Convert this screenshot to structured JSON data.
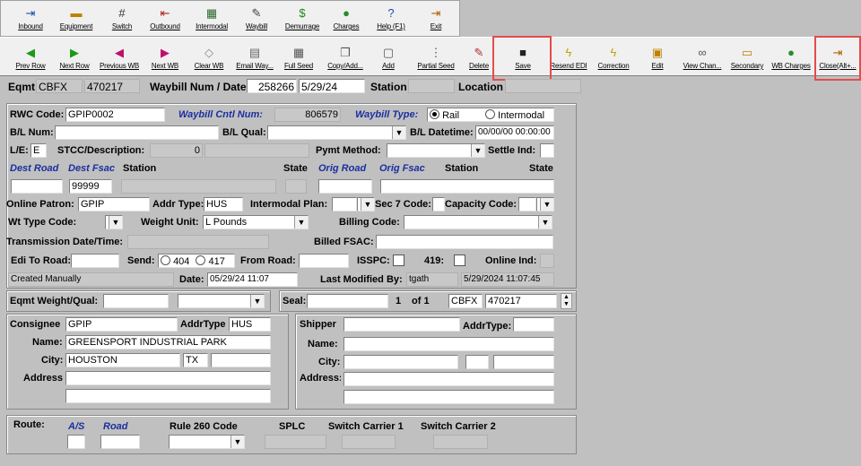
{
  "toolbar1": [
    {
      "label": "Inbound",
      "icon": "inbound-icon",
      "glyph": "⇥",
      "color": "#1a4fb0"
    },
    {
      "label": "Equipment",
      "icon": "equipment-icon",
      "glyph": "▬",
      "color": "#c08000"
    },
    {
      "label": "Switch",
      "icon": "switch-icon",
      "glyph": "#",
      "color": "#333"
    },
    {
      "label": "Outbound",
      "icon": "outbound-icon",
      "glyph": "⇤",
      "color": "#b02020"
    },
    {
      "label": "Intermodal",
      "icon": "intermodal-icon",
      "glyph": "▦",
      "color": "#2a6a2a"
    },
    {
      "label": "Waybill",
      "icon": "waybill-icon",
      "glyph": "✎",
      "color": "#444"
    },
    {
      "label": "Demurrage",
      "icon": "demurrage-icon",
      "glyph": "$",
      "color": "#1a8a1a"
    },
    {
      "label": "Charges",
      "icon": "charges-icon",
      "glyph": "●",
      "color": "#2a8a2a"
    },
    {
      "label": "Help (F1)",
      "icon": "help-icon",
      "glyph": "?",
      "color": "#1a4fb0"
    },
    {
      "label": "Exit",
      "icon": "exit-icon",
      "glyph": "⇥",
      "color": "#b06000"
    }
  ],
  "toolbar2": [
    {
      "label": "Prev Row",
      "icon": "prev-row-icon",
      "glyph": "◀",
      "color": "#1a9a1a"
    },
    {
      "label": "Next Row",
      "icon": "next-row-icon",
      "glyph": "▶",
      "color": "#1a9a1a"
    },
    {
      "label": "Previous WB",
      "icon": "previous-wb-icon",
      "glyph": "◀",
      "color": "#c0106a"
    },
    {
      "label": "Next WB",
      "icon": "next-wb-icon",
      "glyph": "▶",
      "color": "#c0106a"
    },
    {
      "label": "Clear WB",
      "icon": "clear-wb-icon",
      "glyph": "◇",
      "color": "#888"
    },
    {
      "label": "Email Way...",
      "icon": "email-waybill-icon",
      "glyph": "▤",
      "color": "#666"
    },
    {
      "label": "Full Seed",
      "icon": "full-seed-icon",
      "glyph": "▦",
      "color": "#555"
    },
    {
      "label": "Copy/Add...",
      "icon": "copy-add-icon",
      "glyph": "❐",
      "color": "#555"
    },
    {
      "label": "Add",
      "icon": "add-icon",
      "glyph": "▢",
      "color": "#555"
    },
    {
      "label": "Partial Seed",
      "icon": "partial-seed-icon",
      "glyph": "⋮",
      "color": "#555"
    },
    {
      "label": "Delete",
      "icon": "delete-icon",
      "glyph": "✎",
      "color": "#b03030"
    },
    {
      "label": "Save",
      "icon": "save-icon",
      "glyph": "■",
      "color": "#222"
    },
    {
      "label": "Resend EDI",
      "icon": "resend-edi-icon",
      "glyph": "ϟ",
      "color": "#c8a000"
    },
    {
      "label": "Correction",
      "icon": "correction-icon",
      "glyph": "ϟ",
      "color": "#c8a000"
    },
    {
      "label": "Edit",
      "icon": "edit-icon",
      "glyph": "▣",
      "color": "#c08000"
    },
    {
      "label": "View Chan...",
      "icon": "view-changes-icon",
      "glyph": "∞",
      "color": "#555"
    },
    {
      "label": "Secondary",
      "icon": "secondary-icon",
      "glyph": "▭",
      "color": "#c08000"
    },
    {
      "label": "WB Charges",
      "icon": "wb-charges-icon",
      "glyph": "●",
      "color": "#2a8a2a"
    },
    {
      "label": "Close(Alt+...",
      "icon": "close-icon",
      "glyph": "⇥",
      "color": "#b06000"
    }
  ],
  "header": {
    "eqmt_label": "Eqmt",
    "eqmt_init": "CBFX",
    "eqmt_num": "470217",
    "wb_label": "Waybill Num / Date",
    "wb_num": "258266",
    "wb_date": "5/29/24",
    "station_label": "Station",
    "station": "",
    "location_label": "Location",
    "location": ""
  },
  "form": {
    "rwc_label": "RWC Code:",
    "rwc": "GPIP0002",
    "cntl_label": "Waybill Cntl Num:",
    "cntl": "806579",
    "type_label": "Waybill Type:",
    "type_rail": "Rail",
    "type_intermodal": "Intermodal",
    "bl_num_label": "B/L Num:",
    "bl_num": "",
    "bl_qual_label": "B/L Qual:",
    "bl_qual": "",
    "bl_dt_label": "B/L Datetime:",
    "bl_dt": "00/00/00 00:00:00",
    "le_label": "L/E:",
    "le": "E",
    "stcc_label": "STCC/Description:",
    "stcc": "0",
    "stcc_desc": "",
    "pymt_label": "Pymt Method:",
    "pymt": "",
    "settle_label": "Settle Ind:",
    "settle": "",
    "dest_road_label": "Dest Road",
    "dest_fsac_label": "Dest Fsac",
    "dest_station_label": "Station",
    "dest_state_label": "State",
    "orig_road_label": "Orig Road",
    "orig_fsac_label": "Orig Fsac",
    "orig_station_label": "Station",
    "orig_state_label": "State",
    "dest_road": "",
    "dest_fsac": "99999",
    "dest_station": "",
    "dest_state": "",
    "orig_road": "",
    "orig_fsac": "",
    "online_label": "Online Patron:",
    "online": "GPIP",
    "addr_label": "Addr Type:",
    "addr": "HUS",
    "im_plan_label": "Intermodal Plan:",
    "im_plan": "",
    "sec7_label": "Sec 7 Code:",
    "sec7": "",
    "cap_label": "Capacity Code:",
    "cap": "",
    "wt_type_label": "Wt Type Code:",
    "wt_type": "",
    "wt_unit_label": "Weight Unit:",
    "wt_unit": "L Pounds",
    "billing_label": "Billing Code:",
    "billing": "",
    "trans_label": "Transmission Date/Time:",
    "trans": "",
    "billed_fsac_label": "Billed FSAC:",
    "billed_fsac": "",
    "edi_label": "Edi To Road:",
    "edi": "",
    "send_label": "Send:",
    "send_404": "404",
    "send_417": "417",
    "from_road_label": "From Road:",
    "from_road": "",
    "isspc_label": "ISSPC:",
    "n419_label": "419:",
    "online_ind_label": "Online Ind:",
    "online_ind": "",
    "created": "Created Manually",
    "date_label": "Date:",
    "date": "05/29/24 11:07",
    "lastmod_label": "Last Modified By:",
    "lastmod_user": "tgath",
    "lastmod_date": "5/29/2024 11:07:45"
  },
  "weight": {
    "label": "Eqmt Weight/Qual:",
    "value": "",
    "qual": ""
  },
  "seal": {
    "label": "Seal:",
    "value": "",
    "index": "1",
    "of": "of 1",
    "init": "CBFX",
    "num": "470217"
  },
  "consignee": {
    "label": "Consignee",
    "code": "GPIP",
    "addrtype_label": "AddrType",
    "addrtype": "HUS",
    "name_label": "Name:",
    "name": "GREENSPORT INDUSTRIAL PARK",
    "city_label": "City:",
    "city": "HOUSTON",
    "state": "TX",
    "zip": "",
    "address_label": "Address:",
    "addr1": "",
    "addr2": ""
  },
  "shipper": {
    "label": "Shipper",
    "code": "",
    "addrtype_label": "AddrType:",
    "addrtype": "",
    "name_label": "Name:",
    "name": "",
    "city_label": "City:",
    "city": "",
    "state": "",
    "zip": "",
    "address_label": "Address:",
    "addr1": "",
    "addr2": ""
  },
  "route": {
    "label": "Route:",
    "as_label": "A/S",
    "road_label": "Road",
    "rule260_label": "Rule 260 Code",
    "splc_label": "SPLC",
    "sw1_label": "Switch Carrier 1",
    "sw2_label": "Switch Carrier 2",
    "as": "",
    "road": "",
    "rule260": "",
    "splc": "",
    "sw1": "",
    "sw2": ""
  }
}
